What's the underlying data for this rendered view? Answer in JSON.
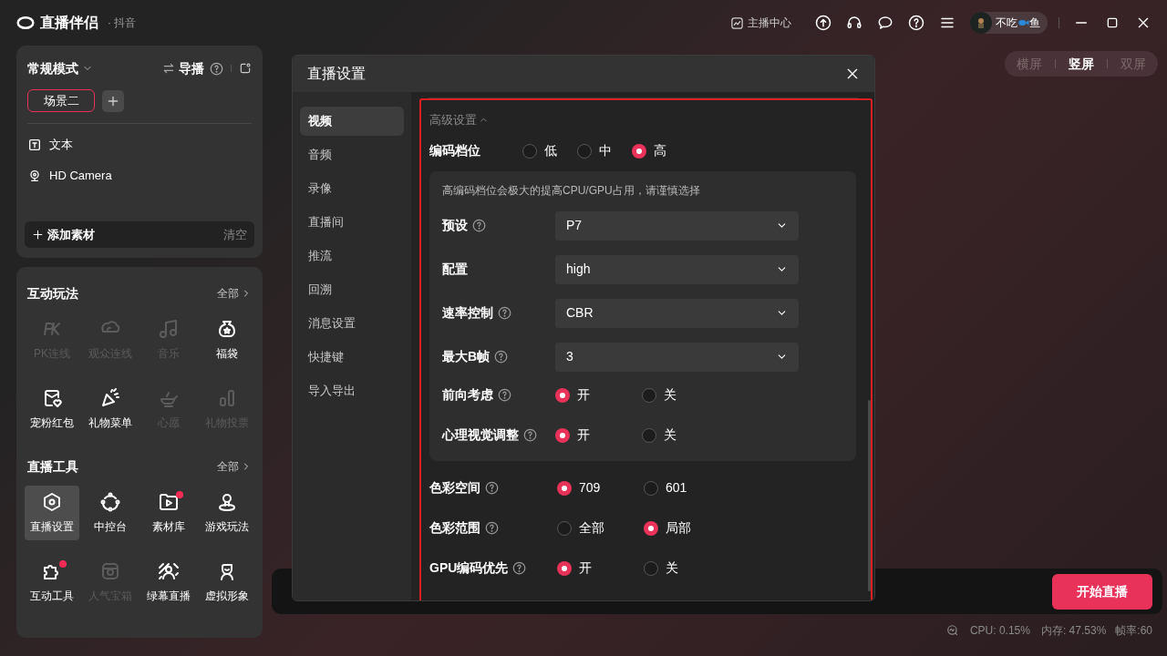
{
  "app": {
    "title": "直播伴侣",
    "platform": "· 抖音"
  },
  "header": {
    "creator_center": "主播中心",
    "user_name_start": "不吃",
    "user_name_end": "鱼"
  },
  "orientation_tabs": [
    {
      "label": "横屏",
      "selected": false
    },
    {
      "label": "竖屏",
      "selected": true
    },
    {
      "label": "双屏",
      "selected": false
    }
  ],
  "scene_panel": {
    "mode": "常规模式",
    "director": "导播",
    "scenes": [
      {
        "label": "场景二",
        "selected": true
      }
    ],
    "sources": [
      {
        "kind": "text",
        "label": "文本"
      },
      {
        "kind": "camera",
        "label": "HD Camera"
      }
    ],
    "add_source": "添加素材",
    "clear": "清空"
  },
  "interactive": {
    "title": "互动玩法",
    "more": "全部",
    "items": [
      {
        "label": "PK连线",
        "disabled": true,
        "notification": false
      },
      {
        "label": "观众连线",
        "disabled": true,
        "notification": false
      },
      {
        "label": "音乐",
        "disabled": true,
        "notification": false
      },
      {
        "label": "福袋",
        "disabled": false,
        "notification": false
      },
      {
        "label": "宠粉红包",
        "disabled": false,
        "notification": false
      },
      {
        "label": "礼物菜单",
        "disabled": false,
        "notification": false
      },
      {
        "label": "心愿",
        "disabled": true,
        "notification": false
      },
      {
        "label": "礼物投票",
        "disabled": true,
        "notification": false
      }
    ]
  },
  "tools": {
    "title": "直播工具",
    "more": "全部",
    "items": [
      {
        "label": "直播设置",
        "selected": true,
        "disabled": false,
        "notification": false
      },
      {
        "label": "中控台",
        "selected": false,
        "disabled": false,
        "notification": false
      },
      {
        "label": "素材库",
        "selected": false,
        "disabled": false,
        "notification": true
      },
      {
        "label": "游戏玩法",
        "selected": false,
        "disabled": false,
        "notification": false
      },
      {
        "label": "互动工具",
        "selected": false,
        "disabled": false,
        "notification": true
      },
      {
        "label": "人气宝箱",
        "selected": false,
        "disabled": true,
        "notification": false
      },
      {
        "label": "绿幕直播",
        "selected": false,
        "disabled": false,
        "notification": false
      },
      {
        "label": "虚拟形象",
        "selected": false,
        "disabled": false,
        "notification": false
      }
    ]
  },
  "dialog": {
    "title": "直播设置",
    "nav": [
      {
        "label": "视频",
        "selected": true
      },
      {
        "label": "音频",
        "selected": false
      },
      {
        "label": "录像",
        "selected": false
      },
      {
        "label": "直播间",
        "selected": false
      },
      {
        "label": "推流",
        "selected": false
      },
      {
        "label": "回溯",
        "selected": false
      },
      {
        "label": "消息设置",
        "selected": false
      },
      {
        "label": "快捷键",
        "selected": false
      },
      {
        "label": "导入导出",
        "selected": false
      }
    ],
    "advanced": "高级设置",
    "encoding_level": {
      "label": "编码档位",
      "options": [
        {
          "label": "低",
          "selected": false
        },
        {
          "label": "中",
          "selected": false
        },
        {
          "label": "高",
          "selected": true
        }
      ]
    },
    "hint": "高编码档位会极大的提高CPU/GPU占用，请谨慎选择",
    "encoder_rows": [
      {
        "kind": "select",
        "label": "预设",
        "help": true,
        "value": "P7"
      },
      {
        "kind": "select",
        "label": "配置",
        "help": false,
        "value": "high"
      },
      {
        "kind": "select",
        "label": "速率控制",
        "help": true,
        "value": "CBR"
      },
      {
        "kind": "select",
        "label": "最大B帧",
        "help": true,
        "value": "3"
      },
      {
        "kind": "radio",
        "label": "前向考虑",
        "help": true,
        "options": [
          {
            "label": "开",
            "selected": true
          },
          {
            "label": "关",
            "selected": false
          }
        ]
      },
      {
        "kind": "radio",
        "label": "心理视觉调整",
        "help": true,
        "options": [
          {
            "label": "开",
            "selected": true
          },
          {
            "label": "关",
            "selected": false
          }
        ]
      }
    ],
    "color_rows": [
      {
        "label": "色彩空间",
        "help": true,
        "options": [
          {
            "label": "709",
            "selected": true
          },
          {
            "label": "601",
            "selected": false
          }
        ]
      },
      {
        "label": "色彩范围",
        "help": true,
        "options": [
          {
            "label": "全部",
            "selected": false
          },
          {
            "label": "局部",
            "selected": true
          }
        ]
      },
      {
        "label": "GPU编码优先",
        "help": true,
        "options": [
          {
            "label": "开",
            "selected": true
          },
          {
            "label": "关",
            "selected": false
          }
        ]
      }
    ]
  },
  "start_button": "开始直播",
  "stats": {
    "cpu": "CPU: 0.15%",
    "memory": "内存: 47.53%",
    "fps": "帧率:60"
  }
}
